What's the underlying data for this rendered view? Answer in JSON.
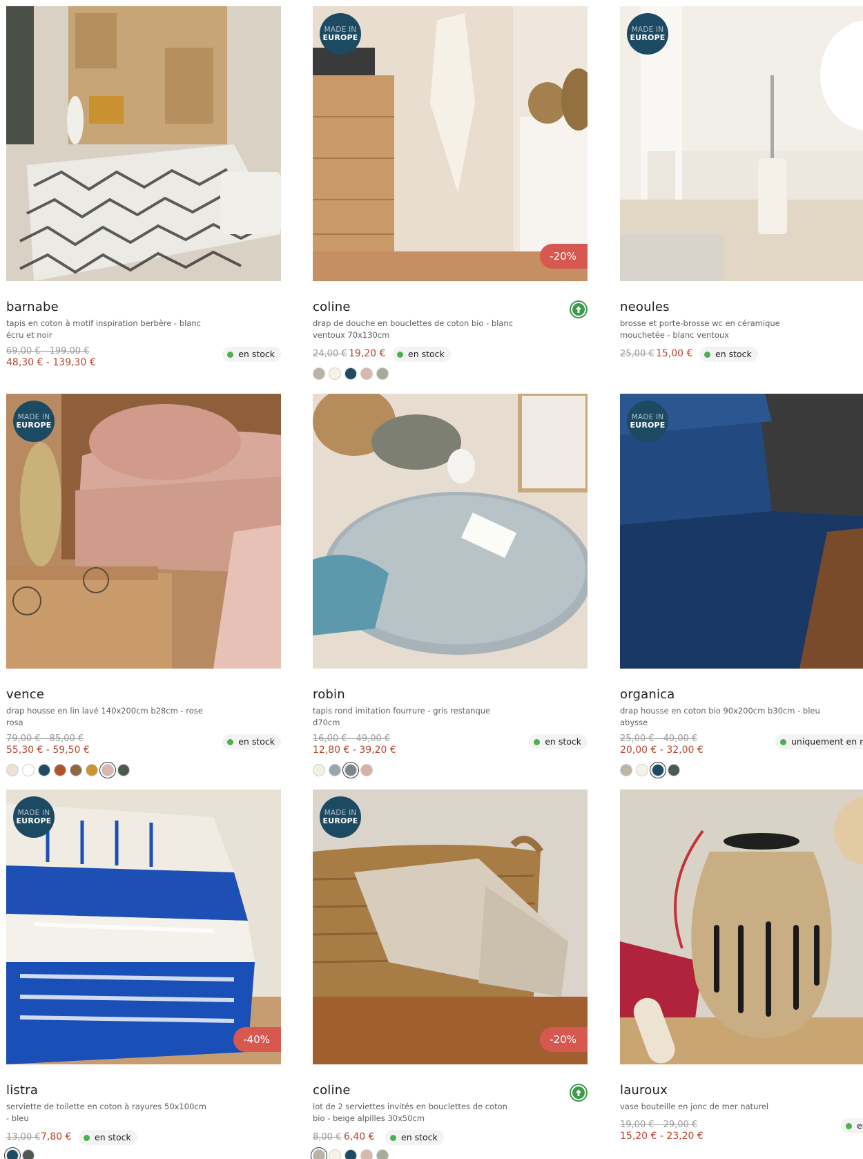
{
  "colors": {
    "badge_blue": "#1c4a63",
    "discount_red": "#d7584f",
    "price_red": "#b8432e",
    "stock_green": "#4caf50",
    "eco_green": "#3d9a4a"
  },
  "badge": {
    "line1": "MADE IN",
    "line2": "EUROPE"
  },
  "products": [
    {
      "name": "barnabe",
      "desc": "tapis en coton à motif inspiration berbère - blanc écru et noir",
      "price_old": "69,00 € - 199,00 €",
      "price_new": "48,30 € - 139,30 €",
      "stock": "en stock",
      "made_in_europe": false,
      "discount": "",
      "swatches": []
    },
    {
      "name": "coline",
      "desc": "drap de douche en bouclettes de coton bio - blanc ventoux 70x130cm",
      "price_old": "24,00 €",
      "price_new": "19,20 €",
      "stock": "en stock",
      "made_in_europe": true,
      "discount": "-20%",
      "eco_icon": "organic-cotton-icon",
      "swatches": [
        "#b9b2a6",
        "#f6f3e6",
        "#1f4a66",
        "#d9b8ad",
        "#a7ac9a"
      ]
    },
    {
      "name": "neoules",
      "desc": "brosse et porte-brosse wc en céramique mouchetée - blanc ventoux",
      "price_old": "25,00 €",
      "price_new": "15,00 €",
      "stock": "en stock",
      "made_in_europe": true,
      "discount": "",
      "swatches": []
    },
    {
      "name": "vence",
      "desc": "drap housse en lin lavé 140x200cm b28cm - rose rosa",
      "price_old": "79,00 € - 85,00 €",
      "price_new": "55,30 € - 59,50 €",
      "stock": "en stock",
      "made_in_europe": true,
      "discount": "",
      "swatches": [
        "#ece2d3",
        "#ffffff",
        "#1f4a66",
        "#b2542a",
        "#8a6a3e",
        "#c8952e",
        "#d9b7b0",
        "#4d5a52"
      ]
    },
    {
      "name": "robin",
      "desc": "tapis rond imitation fourrure - gris restanque d70cm",
      "price_old": "16,00 € - 49,00 €",
      "price_new": "12,80 € - 39,20 €",
      "stock": "en stock",
      "made_in_europe": false,
      "discount": "",
      "swatches": [
        "#f4efe3",
        "#98a6ad",
        "#7d868b",
        "#d8b2a6"
      ]
    },
    {
      "name": "organica",
      "desc": "drap housse en coton bio 90x200cm b30cm - bleu abysse",
      "price_old": "25,00 € - 40,00 €",
      "price_new": "20,00 € - 32,00 €",
      "stock": "uniquement en m",
      "made_in_europe": true,
      "discount": "",
      "swatches": [
        "#bdb5a6",
        "#f6f3e6",
        "#1f4a66",
        "#4d5a52"
      ]
    },
    {
      "name": "listra",
      "desc": "serviette de toilette en coton à rayures 50x100cm - bleu",
      "price_old": "13,00 €",
      "price_new": "7,80 €",
      "stock": "en stock",
      "made_in_europe": true,
      "discount": "-40%",
      "swatches": [
        "#1f4a66",
        "#4d5a52"
      ]
    },
    {
      "name": "coline",
      "desc": "lot de 2 serviettes invités en bouclettes de coton bio - beige alpilles 30x50cm",
      "price_old": "8,00 €",
      "price_new": "6,40 €",
      "stock": "en stock",
      "made_in_europe": true,
      "discount": "-20%",
      "eco_icon": "organic-cotton-icon",
      "swatches": [
        "#b9b2a6",
        "#f6f3e6",
        "#1f4a66",
        "#d9b8ad",
        "#a7ac9a"
      ]
    },
    {
      "name": "lauroux",
      "desc": "vase bouteille en jonc de mer naturel",
      "price_old": "19,00 € - 29,00 €",
      "price_new": "15,20 € - 23,20 €",
      "stock": "en",
      "made_in_europe": false,
      "discount": "",
      "swatches": []
    }
  ]
}
